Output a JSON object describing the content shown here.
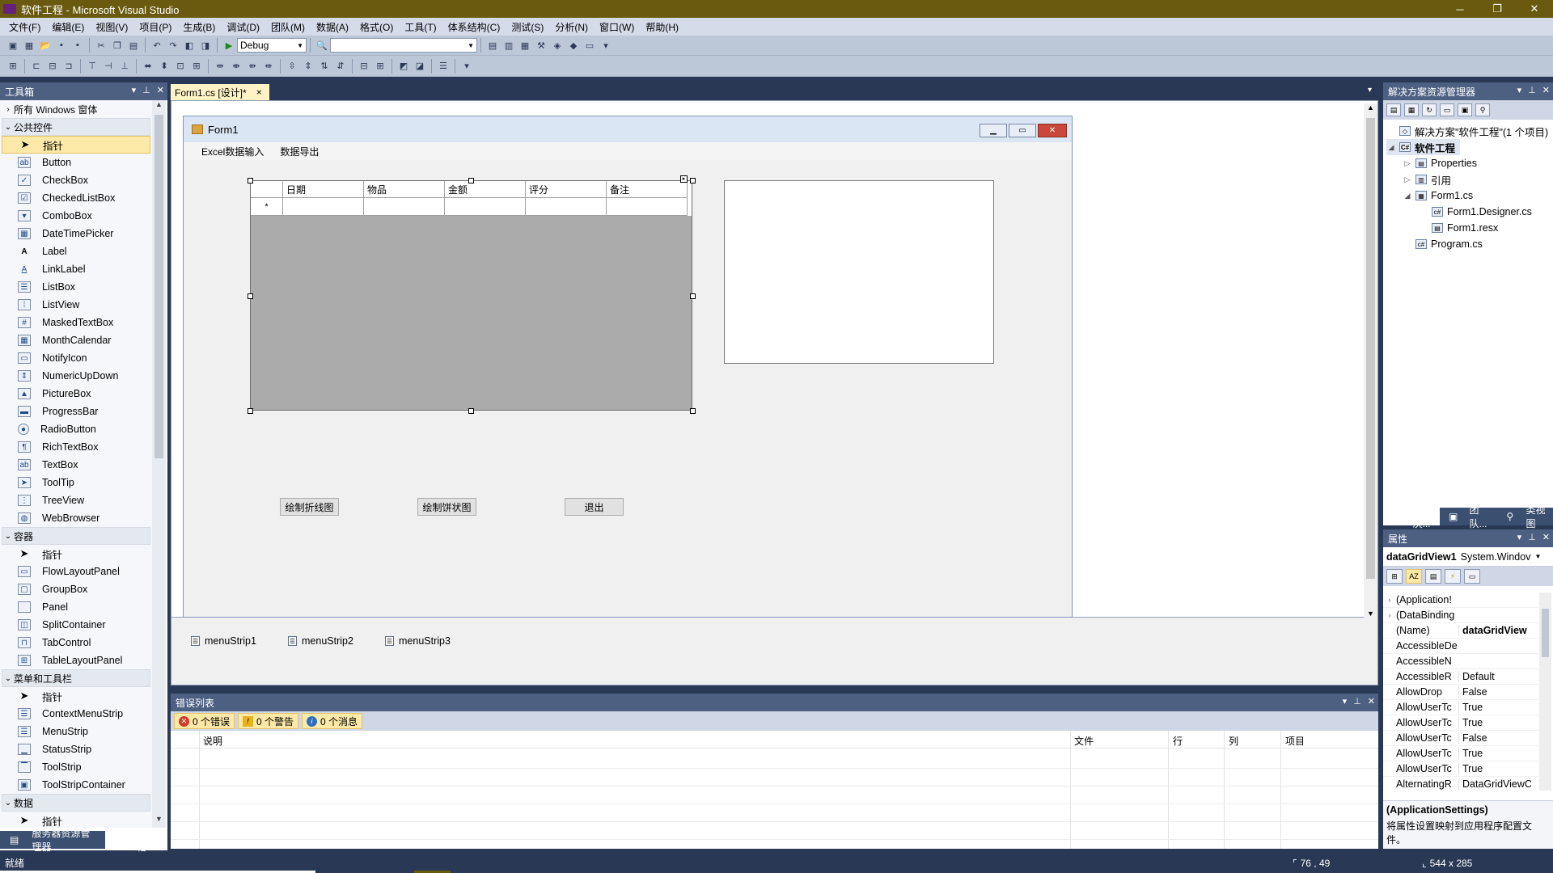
{
  "window": {
    "title": "软件工程 - Microsoft Visual Studio",
    "minimize": "─",
    "restore": "❐",
    "close": "✕"
  },
  "menubar": [
    "文件(F)",
    "编辑(E)",
    "视图(V)",
    "项目(P)",
    "生成(B)",
    "调试(D)",
    "团队(M)",
    "数据(A)",
    "格式(O)",
    "工具(T)",
    "体系结构(C)",
    "测试(S)",
    "分析(N)",
    "窗口(W)",
    "帮助(H)"
  ],
  "toolbar": {
    "config": "Debug",
    "find": ""
  },
  "toolbox": {
    "title": "工具箱",
    "categories": {
      "all_windows_forms": "所有 Windows 窗体",
      "common": "公共控件",
      "containers": "容器",
      "menus": "菜单和工具栏",
      "data": "数据"
    },
    "common_items": [
      "指针",
      "Button",
      "CheckBox",
      "CheckedListBox",
      "ComboBox",
      "DateTimePicker",
      "Label",
      "LinkLabel",
      "ListBox",
      "ListView",
      "MaskedTextBox",
      "MonthCalendar",
      "NotifyIcon",
      "NumericUpDown",
      "PictureBox",
      "ProgressBar",
      "RadioButton",
      "RichTextBox",
      "TextBox",
      "ToolTip",
      "TreeView",
      "WebBrowser"
    ],
    "container_items": [
      "指针",
      "FlowLayoutPanel",
      "GroupBox",
      "Panel",
      "SplitContainer",
      "TabControl",
      "TableLayoutPanel"
    ],
    "menu_items": [
      "指针",
      "ContextMenuStrip",
      "MenuStrip",
      "StatusStrip",
      "ToolStrip",
      "ToolStripContainer"
    ],
    "data_items": [
      "指针"
    ],
    "tabs": {
      "server_explorer": "服务器资源管理器",
      "toolbox": "工具箱"
    }
  },
  "document": {
    "tab_label": "Form1.cs [设计]*",
    "tab_close": "×",
    "form": {
      "title": "Form1",
      "menu": [
        "Excel数据输入",
        "数据导出"
      ],
      "grid_columns": [
        "日期",
        "物品",
        "金额",
        "评分",
        "备注"
      ],
      "new_row_marker": "*",
      "buttons": {
        "line_chart": "绘制折线图",
        "pie_chart": "绘制饼状图",
        "exit": "退出"
      }
    },
    "tray": [
      "menuStrip1",
      "menuStrip2",
      "menuStrip3"
    ]
  },
  "error_list": {
    "title": "错误列表",
    "errors": "0 个错误",
    "warnings": "0 个警告",
    "messages": "0 个消息",
    "columns": {
      "description": "说明",
      "file": "文件",
      "line": "行",
      "column": "列",
      "project": "项目"
    }
  },
  "solution_explorer": {
    "title": "解决方案资源管理器",
    "solution": "解决方案\"软件工程\"(1 个项目)",
    "project": "软件工程",
    "properties": "Properties",
    "references": "引用",
    "form_file": "Form1.cs",
    "designer_file": "Form1.Designer.cs",
    "resx_file": "Form1.resx",
    "program_file": "Program.cs",
    "tabs": [
      "解决...",
      "团队...",
      "类视图"
    ]
  },
  "properties": {
    "title": "属性",
    "object_name": "dataGridView1",
    "object_type": "System.Windov",
    "rows": [
      {
        "name": "(Application!",
        "value": "",
        "expand": "›"
      },
      {
        "name": "(DataBinding",
        "value": "",
        "expand": "›"
      },
      {
        "name": "(Name)",
        "value": "dataGridView",
        "bold": true
      },
      {
        "name": "AccessibleDe",
        "value": ""
      },
      {
        "name": "AccessibleN",
        "value": ""
      },
      {
        "name": "AccessibleR",
        "value": "Default"
      },
      {
        "name": "AllowDrop",
        "value": "False"
      },
      {
        "name": "AllowUserTc",
        "value": "True"
      },
      {
        "name": "AllowUserTc",
        "value": "True"
      },
      {
        "name": "AllowUserTc",
        "value": "False"
      },
      {
        "name": "AllowUserTc",
        "value": "True"
      },
      {
        "name": "AllowUserTc",
        "value": "True"
      },
      {
        "name": "AlternatingR",
        "value": "DataGridViewC"
      }
    ],
    "desc_title": "(ApplicationSettings)",
    "desc_text": "将属性设置映射到应用程序配置文件。"
  },
  "status": {
    "ready": "就绪",
    "position": "76 , 49",
    "size": "544 x 285"
  },
  "colors": {
    "title_bg": "#6a5a10",
    "chrome": "#293955",
    "selection": "#fde9a7"
  }
}
